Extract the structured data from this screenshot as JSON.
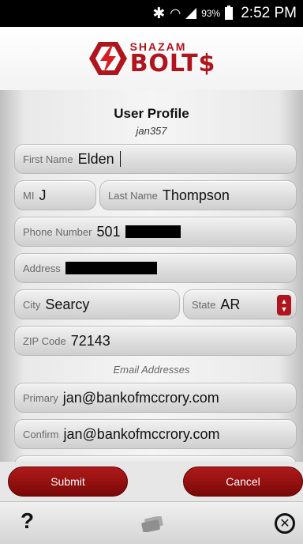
{
  "status_bar": {
    "battery_pct": "93%",
    "time": "2:52 PM"
  },
  "app": {
    "logo_top": "SHAZAM",
    "logo_bottom": "BOLT$"
  },
  "profile": {
    "title": "User Profile",
    "username": "jan357"
  },
  "form": {
    "first_name": {
      "label": "First Name",
      "value": "Elden"
    },
    "mi": {
      "label": "MI",
      "value": "J"
    },
    "last_name": {
      "label": "Last Name",
      "value": "Thompson"
    },
    "phone": {
      "label": "Phone Number",
      "value": "501"
    },
    "address": {
      "label": "Address",
      "value": ""
    },
    "city": {
      "label": "City",
      "value": "Searcy"
    },
    "state": {
      "label": "State",
      "value": "AR"
    },
    "zip": {
      "label": "ZIP Code",
      "value": "72143"
    },
    "email_section": "Email Addresses",
    "primary_email": {
      "label": "Primary",
      "value": "jan@bankofmccrory.com"
    },
    "confirm_email": {
      "label": "Confirm",
      "value": "jan@bankofmccrory.com"
    }
  },
  "actions": {
    "submit": "Submit",
    "cancel": "Cancel"
  },
  "footer": {
    "help": "?",
    "icons": [
      "help-icon",
      "card-icon",
      "close-icon"
    ]
  },
  "colors": {
    "brand_red": "#b0141c",
    "button_red": "#8b0c0c"
  }
}
